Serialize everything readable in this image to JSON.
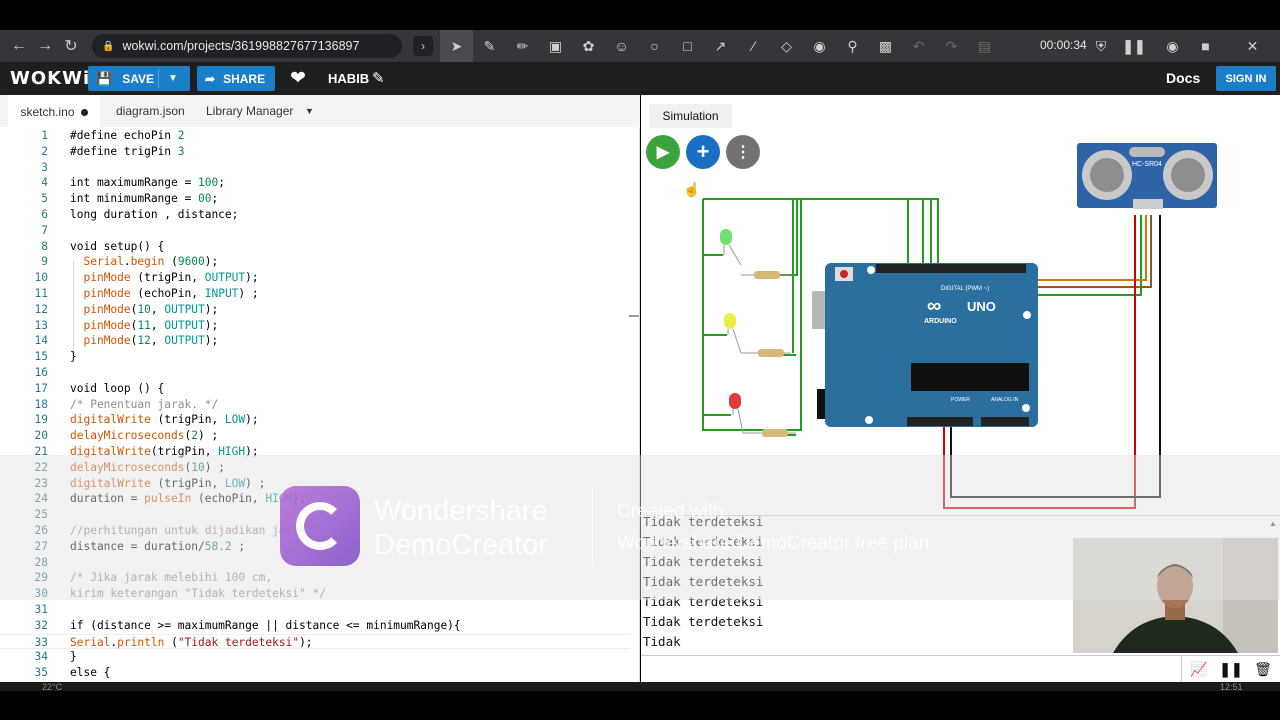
{
  "browser": {
    "url": "wokwi.com/projects/361998827677136897",
    "timer": "00:00:34",
    "nav_icons": [
      "back-arrow-icon",
      "forward-arrow-icon",
      "reload-icon"
    ],
    "draw_tools": [
      "select-arrow-icon",
      "pen-icon",
      "highlighter-icon",
      "text-icon",
      "stamp-icon",
      "emoji-icon",
      "circle-icon",
      "square-icon",
      "arrow-icon",
      "line-icon",
      "eraser-icon",
      "focus-icon",
      "magnifier-icon",
      "screenshot-icon",
      "undo-icon",
      "redo-icon",
      "clear-icon"
    ],
    "record_tools": [
      "shield-icon",
      "pause-icon",
      "webcam-icon",
      "stop-icon",
      "close-icon"
    ]
  },
  "wokwi": {
    "logo": "WOKWi",
    "save_label": "SAVE",
    "share_label": "SHARE",
    "username": "HABIB",
    "docs_label": "Docs",
    "signin_label": "SIGN IN"
  },
  "editor": {
    "tabs": [
      "sketch.ino",
      "diagram.json",
      "Library Manager"
    ],
    "lines": [
      {
        "n": "1",
        "t": "#define echoPin 2"
      },
      {
        "n": "2",
        "t": "#define trigPin 3"
      },
      {
        "n": "3",
        "t": ""
      },
      {
        "n": "4",
        "t": "int maximumRange = 100;"
      },
      {
        "n": "5",
        "t": "int minimumRange = 00;"
      },
      {
        "n": "6",
        "t": "long duration , distance;"
      },
      {
        "n": "7",
        "t": ""
      },
      {
        "n": "8",
        "t": "void setup() {"
      },
      {
        "n": "9",
        "t": "  Serial.begin (9600);"
      },
      {
        "n": "10",
        "t": "  pinMode (trigPin, OUTPUT);"
      },
      {
        "n": "11",
        "t": "  pinMode (echoPin, INPUT) ;"
      },
      {
        "n": "12",
        "t": "  pinMode(10, OUTPUT);"
      },
      {
        "n": "13",
        "t": "  pinMode(11, OUTPUT);"
      },
      {
        "n": "14",
        "t": "  pinMode(12, OUTPUT);"
      },
      {
        "n": "15",
        "t": "}"
      },
      {
        "n": "16",
        "t": ""
      },
      {
        "n": "17",
        "t": "void loop () {"
      },
      {
        "n": "18",
        "t": "/* Penentuan jarak. */"
      },
      {
        "n": "19",
        "t": "digitalWrite (trigPin, LOW);"
      },
      {
        "n": "20",
        "t": "delayMicroseconds(2) ;"
      },
      {
        "n": "21",
        "t": "digitalWrite(trigPin, HIGH);"
      },
      {
        "n": "22",
        "t": "delayMicroseconds(10) ;"
      },
      {
        "n": "23",
        "t": "digitalWrite (trigPin, LOW) ;"
      },
      {
        "n": "24",
        "t": "duration = pulseIn (echoPin, HIGH);"
      },
      {
        "n": "25",
        "t": ""
      },
      {
        "n": "26",
        "t": "//perhitungan untuk dijadikan jarak"
      },
      {
        "n": "27",
        "t": "distance = duration/58.2 ;"
      },
      {
        "n": "28",
        "t": ""
      },
      {
        "n": "29",
        "t": "/* Jika jarak melebihi 100 cm,"
      },
      {
        "n": "30",
        "t": "kirim keterangan \"Tidak terdeteksi\" */"
      },
      {
        "n": "31",
        "t": ""
      },
      {
        "n": "32",
        "t": "if (distance >= maximumRange || distance <= minimumRange){"
      },
      {
        "n": "33",
        "t": "Serial.println (\"Tidak terdeteksi\");"
      },
      {
        "n": "34",
        "t": "}"
      },
      {
        "n": "35",
        "t": "else {"
      }
    ]
  },
  "simulation": {
    "tab_label": "Simulation",
    "board_label": "UNO",
    "board_brand": "ARDUINO",
    "board_digital": "DIGITAL (PWM ~)",
    "board_power": "POWER",
    "board_analog": "ANALOG IN",
    "sensor_label": "HC-SR04",
    "led_colors": [
      "#5bd35b",
      "#e8e83a",
      "#e23a3a"
    ],
    "wire_green": "#1f9e1f",
    "wire_red": "#d40000",
    "board_color": "#2b6f9f"
  },
  "serial_monitor": {
    "lines": [
      "Tidak terdeteksi",
      "Tidak terdeteksi",
      "Tidak terdeteksi",
      "Tidak terdeteksi",
      "Tidak terdeteksi",
      "Tidak terdeteksi",
      "Tidak"
    ],
    "icons": [
      "chart-icon",
      "pause-icon",
      "trash-icon"
    ]
  },
  "watermark": {
    "title_line1": "Wondershare",
    "title_line2": "DemoCreator",
    "sub_line1": "Created with",
    "sub_line2": "Wondershare DemoCreator free plan"
  },
  "taskbar": {
    "left_text": "22°C",
    "clock": "12:51"
  }
}
